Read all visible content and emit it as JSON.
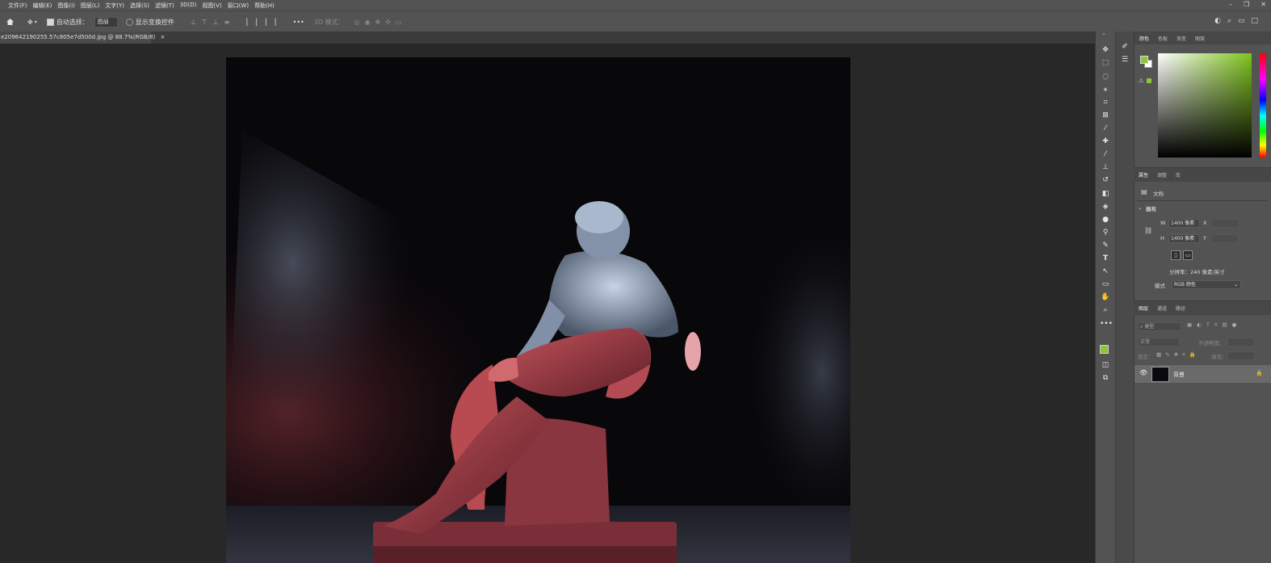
{
  "menu": [
    "文件(F)",
    "编辑(E)",
    "图像(I)",
    "图层(L)",
    "文字(Y)",
    "选择(S)",
    "滤镜(T)",
    "3D(D)",
    "视图(V)",
    "窗口(W)",
    "帮助(H)"
  ],
  "window_controls": [
    "–",
    "❐",
    "✕"
  ],
  "options": {
    "auto_select_label": "自动选择：",
    "layer_select_value": "图层",
    "show_transform_label": "显示变换控件",
    "mode_3d_label": "3D 模式：",
    "more": "•••"
  },
  "document_tab": {
    "title": "e209642190255.57c805e7d500d.jpg @ 88.7%(RGB/8)",
    "close": "×"
  },
  "color_panel": {
    "tabs": [
      "颜色",
      "色板",
      "渐变",
      "图案"
    ],
    "fg": "#8cc43a",
    "bg": "#ffffff"
  },
  "properties_panel": {
    "tabs": [
      "属性",
      "调整",
      "库"
    ],
    "doc_label": "文档",
    "canvas_section": "画布",
    "w_label": "W",
    "w_value": "1400 像素",
    "x_label": "X",
    "h_label": "H",
    "h_value": "1400 像素",
    "y_label": "Y",
    "resolution": "分辨率：240 像素/英寸",
    "mode_label": "模式",
    "mode_value": "RGB 颜色"
  },
  "layers_panel": {
    "tabs": [
      "图层",
      "通道",
      "路径"
    ],
    "filter_placeholder": "类型",
    "blend_mode": "正常",
    "opacity_label": "不透明度：",
    "lock_label": "锁定：",
    "fill_label": "填充：",
    "layers": [
      {
        "name": "背景",
        "visible": true,
        "locked": true
      }
    ]
  },
  "colors": {
    "menu_bg": "#535353",
    "canvas_bg": "#282828",
    "fg_swatch": "#8cc43a"
  }
}
